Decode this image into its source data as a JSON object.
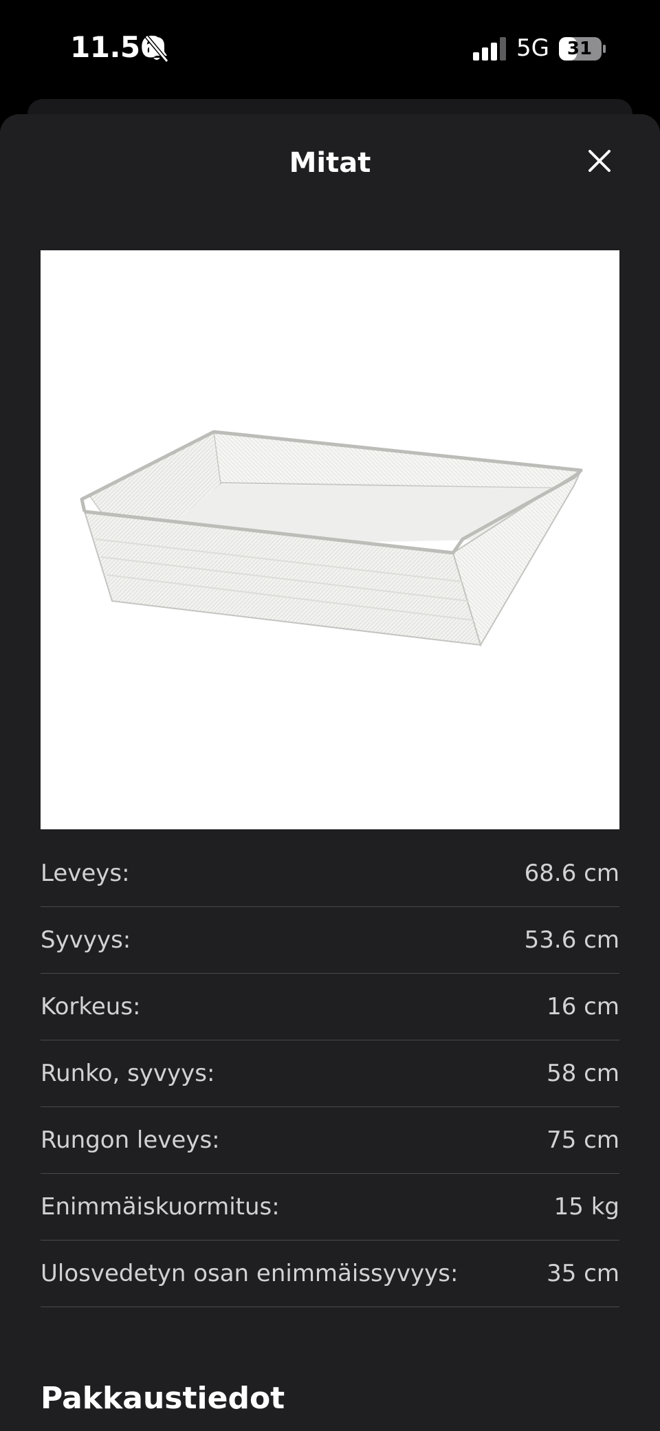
{
  "status_bar": {
    "time": "11.56",
    "network": "5G",
    "battery": "31",
    "icons": [
      "bell-muted-icon",
      "signal-icon",
      "battery-icon"
    ]
  },
  "sheet": {
    "title": "Mitat",
    "close_icon": "close-icon"
  },
  "product_image": {
    "description_icon": "wire-basket-image"
  },
  "dimensions": [
    {
      "label": "Leveys:",
      "value": "68.6 cm"
    },
    {
      "label": "Syvyys:",
      "value": "53.6 cm"
    },
    {
      "label": "Korkeus:",
      "value": "16 cm"
    },
    {
      "label": "Runko, syvyys:",
      "value": "58 cm"
    },
    {
      "label": "Rungon leveys:",
      "value": "75 cm"
    },
    {
      "label": "Enimmäiskuormitus:",
      "value": "15 kg"
    },
    {
      "label": "Ulosvedetyn osan enimmäissyvyys:",
      "value": "35 cm"
    }
  ],
  "packaging": {
    "title": "Pakkaustiedot"
  },
  "colors": {
    "background": "#000000",
    "sheet": "#1f1f21",
    "text_primary": "#ffffff",
    "text_secondary": "#d2d2d4",
    "divider": "#4a4a4c"
  }
}
